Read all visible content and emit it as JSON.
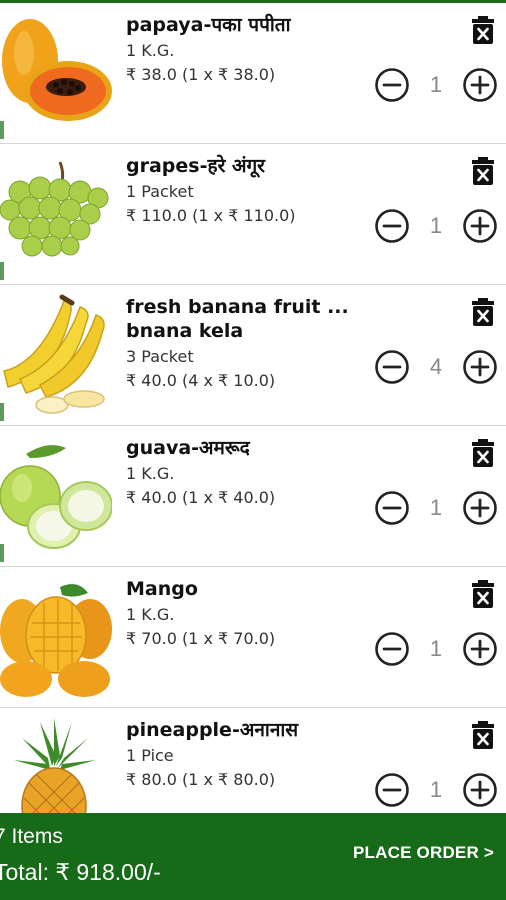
{
  "cart": {
    "items": [
      {
        "name": "papaya-पका पपीता",
        "unit": "1 K.G.",
        "price": "₹ 38.0 (1 x ₹ 38.0)",
        "qty": "1",
        "image": "papaya-image"
      },
      {
        "name": "grapes-हरे अंगूर",
        "unit": "1 Packet",
        "price": "₹ 110.0 (1 x ₹ 110.0)",
        "qty": "1",
        "image": "grapes-image"
      },
      {
        "name_line1": "fresh banana fruit ...",
        "name_line2": "bnana kela",
        "unit": "3 Packet",
        "price": "₹ 40.0 (4 x ₹ 10.0)",
        "qty": "4",
        "image": "banana-image"
      },
      {
        "name": "guava-अमरूद",
        "unit": "1 K.G.",
        "price": "₹ 40.0 (1 x ₹ 40.0)",
        "qty": "1",
        "image": "guava-image"
      },
      {
        "name": "Mango",
        "unit": "1 K.G.",
        "price": "₹ 70.0 (1 x ₹ 70.0)",
        "qty": "1",
        "image": "mango-image"
      },
      {
        "name": "pineapple-अनानास",
        "unit": "1 Pice",
        "price": "₹ 80.0 (1 x ₹ 80.0)",
        "qty": "1",
        "image": "pineapple-image"
      }
    ],
    "icons": {
      "delete": "trash-icon",
      "decrease": "minus-circle-icon",
      "increase": "plus-circle-icon"
    }
  },
  "footer": {
    "items_label": "7 Items",
    "total_label": "Total: ₹ 918.00/-",
    "place_order_label": "PLACE ORDER >"
  },
  "colors": {
    "footer_bg": "#176b18",
    "accent": "#1b6b1b"
  }
}
